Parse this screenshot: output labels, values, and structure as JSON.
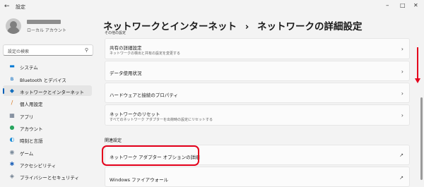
{
  "titlebar": {
    "back_glyph": "←",
    "title": "設定",
    "minimize": "–",
    "maximize": "□",
    "close": "✕"
  },
  "user": {
    "account_type": "ローカル アカウント"
  },
  "search": {
    "placeholder": "設定の検索",
    "icon": "search-icon"
  },
  "sidebar": {
    "items": [
      {
        "label": "システム",
        "icon": "monitor-icon",
        "glyph": "▬",
        "color": "#0078d4"
      },
      {
        "label": "Bluetooth とデバイス",
        "icon": "bluetooth-icon",
        "glyph": "ʙ",
        "color": "#0067c0"
      },
      {
        "label": "ネットワークとインターネット",
        "icon": "wifi-icon",
        "glyph": "◆",
        "color": "#0f6cbd",
        "active": true
      },
      {
        "label": "個人用設定",
        "icon": "brush-icon",
        "glyph": "/",
        "color": "#d6751b"
      },
      {
        "label": "アプリ",
        "icon": "apps-icon",
        "glyph": "▦",
        "color": "#5f6e83"
      },
      {
        "label": "アカウント",
        "icon": "account-icon",
        "glyph": "●",
        "color": "#28a55f"
      },
      {
        "label": "時刻と言語",
        "icon": "globe-clock-icon",
        "glyph": "◐",
        "color": "#1f8fd9"
      },
      {
        "label": "ゲーム",
        "icon": "gamepad-icon",
        "glyph": "◉",
        "color": "#7a8a9a"
      },
      {
        "label": "アクセシビリティ",
        "icon": "accessibility-icon",
        "glyph": "✱",
        "color": "#1b5fb8"
      },
      {
        "label": "プライバシーとセキュリティ",
        "icon": "shield-icon",
        "glyph": "◈",
        "color": "#6b7b8c"
      }
    ]
  },
  "main": {
    "breadcrumb_parent": "ネットワークとインターネット",
    "breadcrumb_sep": "›",
    "breadcrumb_current": "ネットワークの詳細設定",
    "cut_text": "その他の設定",
    "cards": [
      {
        "title": "共有の詳細設定",
        "subtitle": "ネットワークの検出と共有の設定を変更する",
        "action": "chevron"
      },
      {
        "title": "データ使用状況",
        "action": "chevron"
      },
      {
        "title": "ハードウェアと接続のプロパティ",
        "action": "chevron"
      },
      {
        "title": "ネットワークのリセット",
        "subtitle": "すべてのネットワーク アダプターを出荷時の設定にリセットする",
        "action": "chevron"
      }
    ],
    "related_heading": "関連設定",
    "related": [
      {
        "title": "ネットワーク アダプター オプションの詳細",
        "action": "external"
      },
      {
        "title": "Windows ファイアウォール",
        "action": "external"
      }
    ]
  },
  "glyphs": {
    "chevron": "›",
    "external": "↗"
  },
  "colors": {
    "accent": "#005fb8",
    "annotation": "#e4001b"
  }
}
